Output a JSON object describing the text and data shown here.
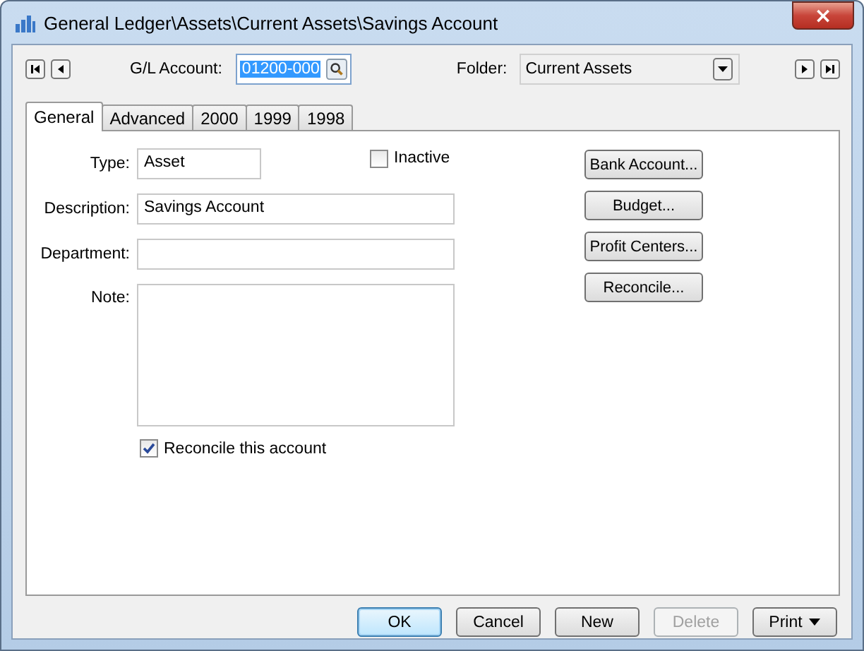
{
  "window": {
    "title": "General Ledger\\Assets\\Current Assets\\Savings Account",
    "close": "×"
  },
  "toolbar": {
    "account_label": "G/L Account:",
    "account_value": "01200-000",
    "folder_label": "Folder:",
    "folder_value": "Current Assets"
  },
  "tabs": [
    {
      "label": "General",
      "selected": true
    },
    {
      "label": "Advanced",
      "selected": false
    },
    {
      "label": "2000",
      "selected": false
    },
    {
      "label": "1999",
      "selected": false
    },
    {
      "label": "1998",
      "selected": false
    }
  ],
  "form": {
    "type_label": "Type:",
    "type_value": "Asset",
    "inactive": {
      "label": "Inactive",
      "checked": false
    },
    "description_label": "Description:",
    "description_value": "Savings Account",
    "department_label": "Department:",
    "note_label": "Note:",
    "reconcile": {
      "label": "Reconcile this account",
      "checked": true
    }
  },
  "side_buttons": [
    "Bank Account...",
    "Budget...",
    "Profit Centers...",
    "Reconcile..."
  ],
  "buttons": [
    {
      "label": "OK",
      "default": true,
      "disabled": false,
      "dropdown": false
    },
    {
      "label": "Cancel",
      "default": false,
      "disabled": false,
      "dropdown": false
    },
    {
      "label": "New",
      "default": false,
      "disabled": false,
      "dropdown": false
    },
    {
      "label": "Delete",
      "default": false,
      "disabled": true,
      "dropdown": false
    },
    {
      "label": "Print",
      "default": false,
      "disabled": false,
      "dropdown": true
    }
  ]
}
